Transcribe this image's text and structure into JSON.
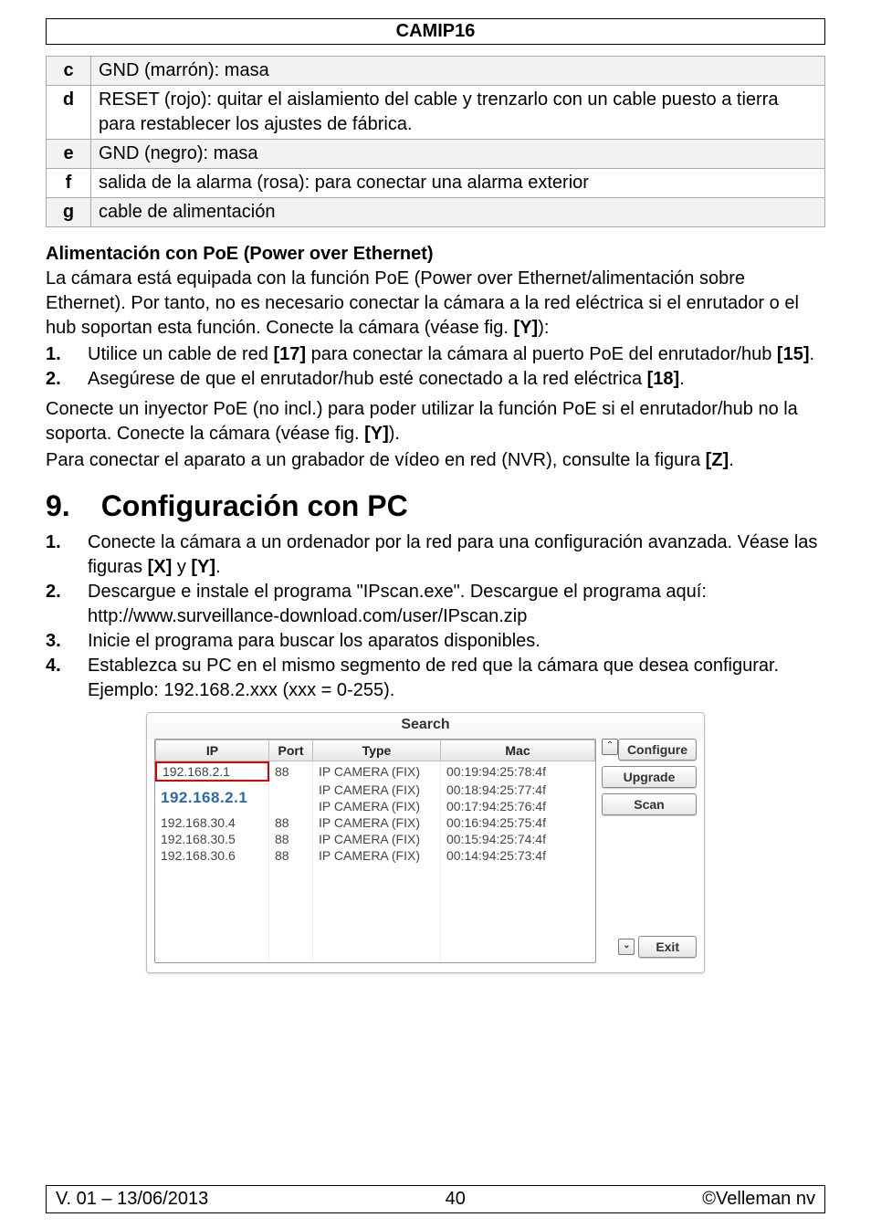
{
  "header": "CAMIP16",
  "rows": [
    {
      "key": "c",
      "text": "GND (marrón): masa",
      "shade": true
    },
    {
      "key": "d",
      "text": "RESET (rojo): quitar el aislamiento del cable y trenzarlo con un cable puesto a tierra para restablecer los ajustes de fábrica.",
      "shade": false
    },
    {
      "key": "e",
      "text": "GND (negro): masa",
      "shade": true
    },
    {
      "key": "f",
      "text": "salida de la alarma (rosa): para conectar una alarma exterior",
      "shade": false
    },
    {
      "key": "g",
      "text": "cable de alimentación",
      "shade": true
    }
  ],
  "poe": {
    "heading": "Alimentación con PoE (Power over Ethernet)",
    "intro": "La cámara está equipada con la función PoE (Power over Ethernet/alimentación sobre Ethernet). Por tanto, no es necesario conectar la cámara a la red eléctrica si el enrutador o el hub soportan esta función. Conecte la cámara (véase fig. ",
    "intro_ref": "[Y]",
    "intro_tail": "):",
    "step1_a": "Utilice un cable de red ",
    "step1_b": "[17]",
    "step1_c": " para conectar la cámara al puerto PoE del enrutador/hub ",
    "step1_d": "[15]",
    "step1_e": ".",
    "step2_a": "Asegúrese de que el enrutador/hub esté conectado a la red eléctrica ",
    "step2_b": "[18]",
    "step2_c": ".",
    "after1_a": "Conecte un inyector PoE (no incl.) para poder utilizar la función PoE si el enrutador/hub no la soporta. Conecte la cámara (véase fig. ",
    "after1_b": "[Y]",
    "after1_c": ").",
    "after2_a": "Para conectar el aparato a un grabador de vídeo en red (NVR), consulte la figura ",
    "after2_b": "[Z]",
    "after2_c": "."
  },
  "section": {
    "num": "9.",
    "title": "Configuración con PC"
  },
  "config_steps": {
    "s1_a": "Conecte la cámara a un ordenador por la red para una configuración avanzada. Véase las figuras ",
    "s1_b": "[X]",
    "s1_c": " y ",
    "s1_d": "[Y]",
    "s1_e": ".",
    "s2_a": "Descargue e instale el programa \"IPscan.exe\". Descargue el programa aquí:",
    "s2_url": "http://www.surveillance-download.com/user/IPscan.zip",
    "s3": "Inicie el programa para buscar los aparatos disponibles.",
    "s4": "Establezca su PC en el mismo segmento de red que la cámara que desea configurar. Ejemplo: 192.168.2.xxx (xxx = 0-255)."
  },
  "search": {
    "title": "Search",
    "col_ip": "IP",
    "col_port": "Port",
    "col_type": "Type",
    "col_mac": "Mac",
    "big_ip": "192.168.2.1",
    "rows": [
      {
        "ip": "192.168.2.1",
        "port": "88",
        "type": "IP CAMERA (FIX)",
        "mac": "00:19:94:25:78:4f",
        "hl": true
      },
      {
        "ip": "",
        "port": "",
        "type": "IP CAMERA (FIX)",
        "mac": "00:18:94:25:77:4f",
        "hl": false
      },
      {
        "ip": "",
        "port": "",
        "type": "IP CAMERA (FIX)",
        "mac": "00:17:94:25:76:4f",
        "hl": false
      },
      {
        "ip": "192.168.30.4",
        "port": "88",
        "type": "IP CAMERA (FIX)",
        "mac": "00:16:94:25:75:4f",
        "hl": false
      },
      {
        "ip": "192.168.30.5",
        "port": "88",
        "type": "IP CAMERA (FIX)",
        "mac": "00:15:94:25:74:4f",
        "hl": false
      },
      {
        "ip": "192.168.30.6",
        "port": "88",
        "type": "IP CAMERA (FIX)",
        "mac": "00:14:94:25:73:4f",
        "hl": false
      }
    ],
    "btn_configure": "Configure",
    "btn_upgrade": "Upgrade",
    "btn_scan": "Scan",
    "btn_exit": "Exit"
  },
  "footer": {
    "left": "V. 01 – 13/06/2013",
    "center": "40",
    "right": "©Velleman nv"
  }
}
